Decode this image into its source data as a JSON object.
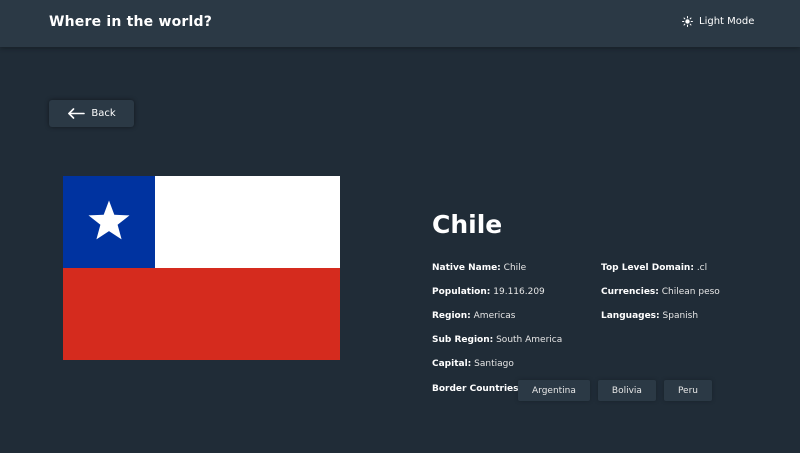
{
  "header": {
    "title": "Where in the world?",
    "theme_toggle_label": "Light Mode",
    "theme_toggle_icon": "sun-icon"
  },
  "back_button": {
    "label": "Back",
    "icon": "arrow-left-icon"
  },
  "country": {
    "name": "Chile",
    "flag": {
      "description_icon": "chile-flag",
      "colors": {
        "blue": "#0033a0",
        "white": "#ffffff",
        "red": "#d52b1e"
      }
    },
    "details_left": [
      {
        "label": "Native Name:",
        "value": "Chile"
      },
      {
        "label": "Population:",
        "value": "19.116.209"
      },
      {
        "label": "Region:",
        "value": "Americas"
      },
      {
        "label": "Sub Region:",
        "value": "South America"
      },
      {
        "label": "Capital:",
        "value": "Santiago"
      }
    ],
    "details_right": [
      {
        "label": "Top Level Domain:",
        "value": ".cl"
      },
      {
        "label": "Currencies:",
        "value": "Chilean peso"
      },
      {
        "label": "Languages:",
        "value": "Spanish"
      }
    ],
    "border_countries_label": "Border Countries:",
    "border_countries": [
      "Argentina",
      "Bolivia",
      "Peru"
    ]
  },
  "colors": {
    "background": "#202c37",
    "elements": "#2b3945",
    "text": "#ffffff"
  }
}
